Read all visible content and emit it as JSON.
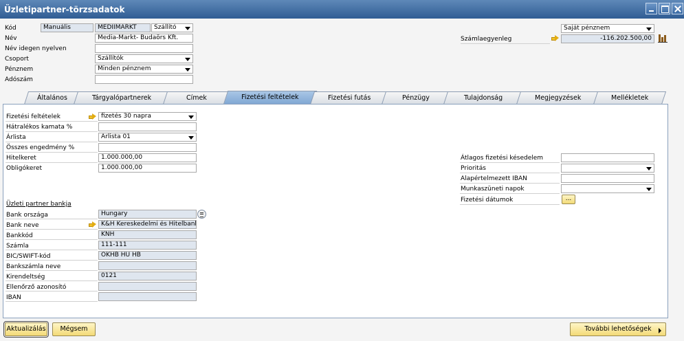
{
  "window": {
    "title": "Üzletipartner-törzsadatok"
  },
  "header": {
    "kod_label": "Kód",
    "kod_series": "Manuális",
    "kod_value": "MEDIIMARKT",
    "kod_type": "Szállító",
    "nev_label": "Név",
    "nev_value": "Media-Markt- Budaörs Kft.",
    "nev_idegen_label": "Név idegen nyelven",
    "nev_idegen_value": "",
    "csoport_label": "Csoport",
    "csoport_value": "Szállítók",
    "penznem_label": "Pénznem",
    "penznem_value": "Minden pénznem",
    "adoszam_label": "Adószám",
    "adoszam_value": "",
    "currency_select": "Saját pénznem",
    "szamlaegyenleg_label": "Számlaegyenleg",
    "szamlaegyenleg_value": "-116.202.500,00"
  },
  "tabs": [
    {
      "label": "Általános",
      "active": false
    },
    {
      "label": "Tárgyalópartnerek",
      "active": false
    },
    {
      "label": "Címek",
      "active": false
    },
    {
      "label": "Fizetési feltételek",
      "active": true
    },
    {
      "label": "Fizetési futás",
      "active": false
    },
    {
      "label": "Pénzügy",
      "active": false
    },
    {
      "label": "Tulajdonság",
      "active": false
    },
    {
      "label": "Megjegyzések",
      "active": false
    },
    {
      "label": "Mellékletek",
      "active": false
    }
  ],
  "payment": {
    "fizetesi_feltetelek_label": "Fizetési feltételek",
    "fizetesi_feltetelek_value": "fizetés 30 napra",
    "hatralekos_label": "Hátralékos kamata %",
    "hatralekos_value": "",
    "arlista_label": "Árlista",
    "arlista_value": "Árlista 01",
    "engedmeny_label": "Összes engedmény %",
    "engedmeny_value": "",
    "hitelkeret_label": "Hitelkeret",
    "hitelkeret_value": "1.000.000,00",
    "obligokeret_label": "Obligókeret",
    "obligokeret_value": "1.000.000,00"
  },
  "right_fields": {
    "atlagos_label": "Átlagos fizetési késedelem",
    "atlagos_value": "",
    "prioritas_label": "Prioritás",
    "prioritas_value": "",
    "iban_label": "Alapértelmezett IBAN",
    "iban_value": "",
    "munkaszuneti_label": "Munkaszüneti napok",
    "munkaszuneti_value": "",
    "datumok_label": "Fizetési dátumok",
    "datumok_button": "..."
  },
  "bank": {
    "section_title": "Üzleti partner bankja",
    "orszag_label": "Bank országa",
    "orszag_value": "Hungary",
    "neve_label": "Bank neve",
    "neve_value": "K&H Kereskedelmi és Hitelbank",
    "kod_label": "Bankkód",
    "kod_value": "KNH",
    "szamla_label": "Számla",
    "szamla_value": "111-111",
    "bic_label": "BIC/SWIFT-kód",
    "bic_value": "OKHB HU HB",
    "szamlaneve_label": "Bankszámla neve",
    "szamlaneve_value": "",
    "kirendeltseg_label": "Kirendeltség",
    "kirendeltseg_value": "0121",
    "ellenorzo_label": "Ellenőrző azonosító",
    "ellenorzo_value": "",
    "iban_label": "IBAN",
    "iban_value": ""
  },
  "footer": {
    "update_label": "Aktualizálás",
    "cancel_label": "Mégsem",
    "more_label": "További lehetőségek"
  }
}
